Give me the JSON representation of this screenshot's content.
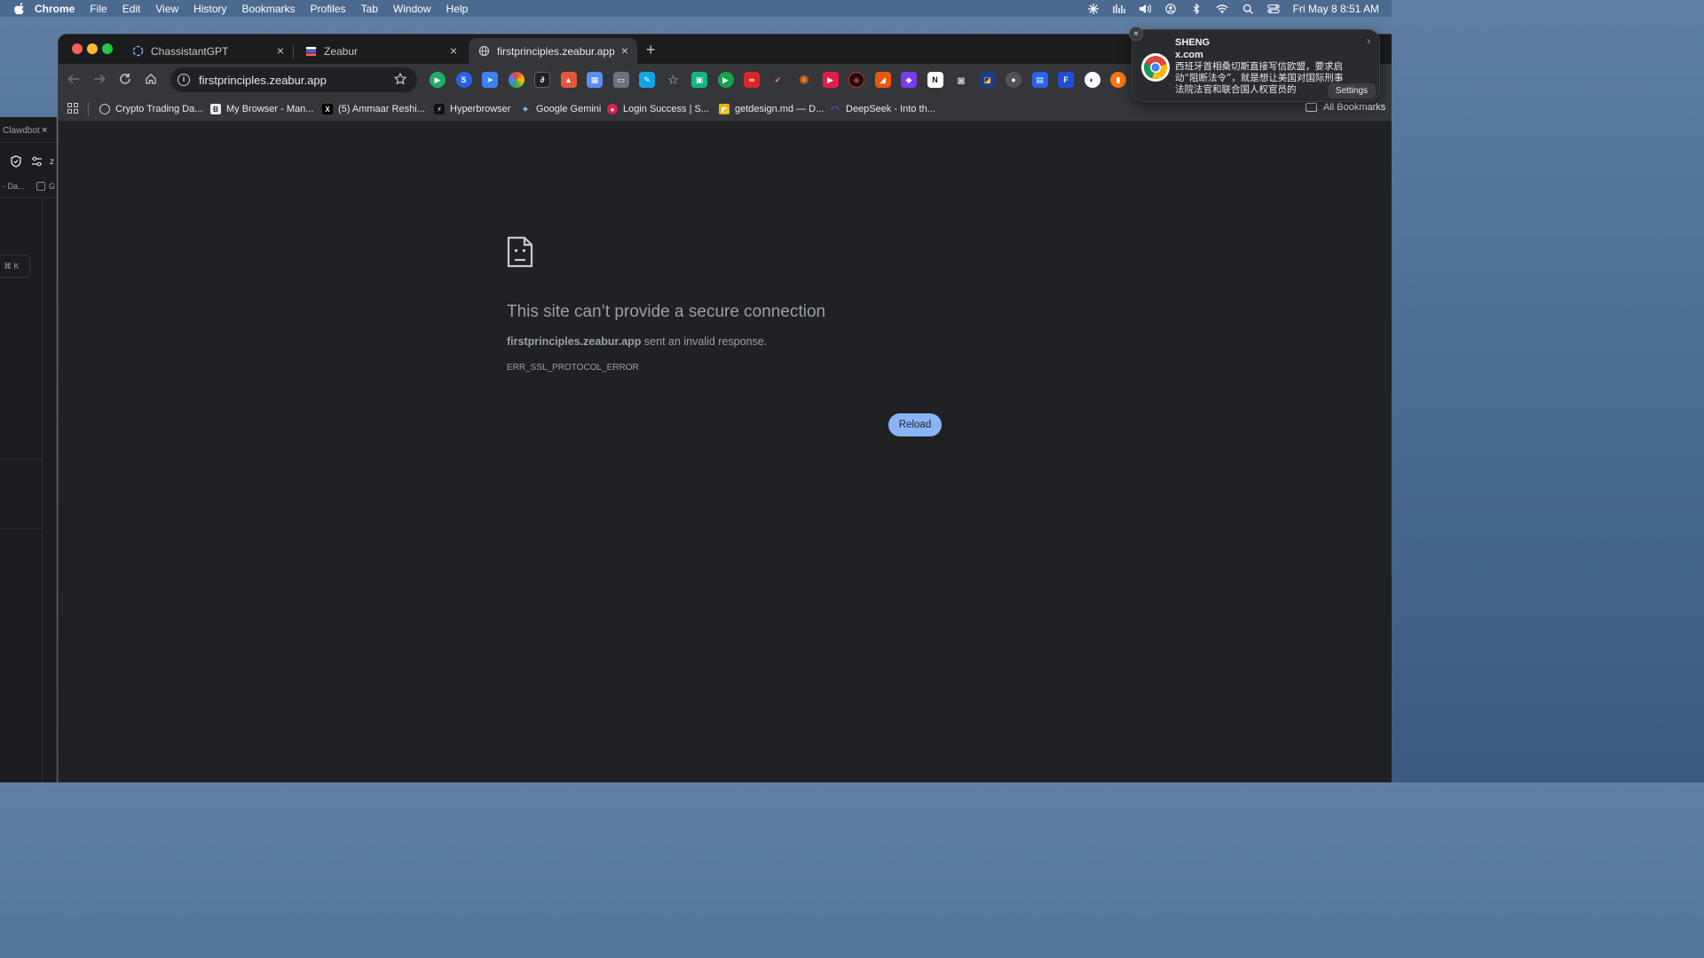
{
  "menubar": {
    "app_name": "Chrome",
    "items": [
      "File",
      "Edit",
      "View",
      "History",
      "Bookmarks",
      "Profiles",
      "Tab",
      "Window",
      "Help"
    ],
    "clock": "Fri May 8  8:51 AM"
  },
  "background_window": {
    "tab_label": "Clawdbot",
    "tab_close": "×",
    "toolbar_fragment": "z",
    "row_fragment": "- Da...",
    "row_fragment_2": "G",
    "shortcut": "⌘ K"
  },
  "tabs": [
    {
      "title": "ChassistantGPT",
      "close": "×"
    },
    {
      "title": "Zeabur",
      "close": "×"
    },
    {
      "title": "firstprinciples.zeabur.app",
      "close": "×"
    }
  ],
  "new_tab": "+",
  "omnibox": {
    "url": "firstprinciples.zeabur.app",
    "info_glyph": "i"
  },
  "bookmarks": [
    {
      "label": "Crypto Trading Da...",
      "icon": "globe-icon"
    },
    {
      "label": "My Browser - Man...",
      "icon": "browser-icon"
    },
    {
      "label": "(5) Ammaar Reshi...",
      "icon": "x-icon"
    },
    {
      "label": "Hyperbrowser",
      "icon": "bolt-icon"
    },
    {
      "label": "Google Gemini",
      "icon": "gemini-icon"
    },
    {
      "label": "Login Success | S...",
      "icon": "login-icon"
    },
    {
      "label": "getdesign.md — D...",
      "icon": "design-icon"
    },
    {
      "label": "DeepSeek - Into th...",
      "icon": "deepseek-icon"
    }
  ],
  "all_bookmarks": "All Bookmarks",
  "error": {
    "title": "This site can’t provide a secure connection",
    "host": "firstprinciples.zeabur.app",
    "message": " sent an invalid response.",
    "code": "ERR_SSL_PROTOCOL_ERROR",
    "reload": "Reload"
  },
  "notification": {
    "title": "SHENG",
    "source": "x.com",
    "body": "西班牙首相桑切斯直接写信欧盟，要求启动“阻断法令”，就是想让美国对国际刑事法院法官和联合国人权官员的",
    "settings": "Settings",
    "close": "×",
    "chevron": "›"
  },
  "colors": {
    "accent": "#8ab4f8",
    "page_bg": "#202124",
    "toolbar_bg": "#35363a"
  }
}
